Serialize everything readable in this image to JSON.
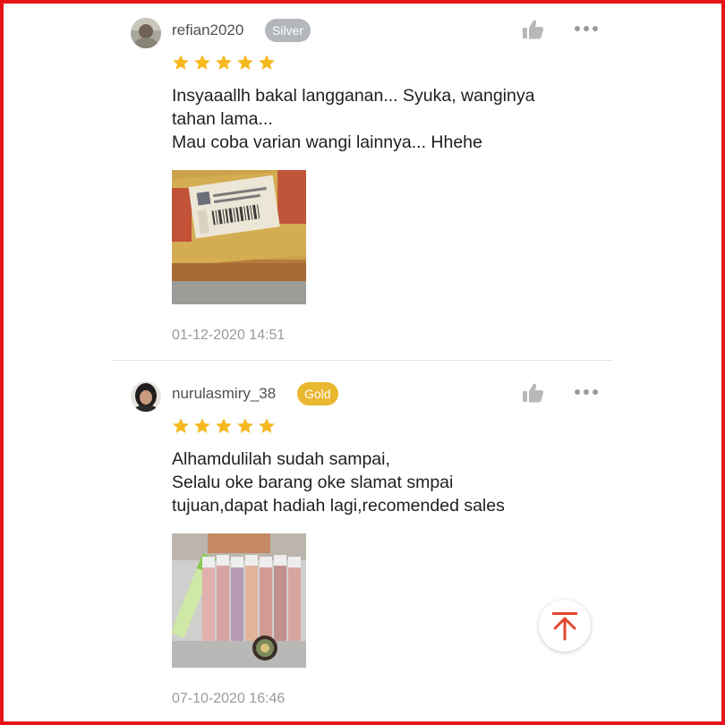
{
  "colors": {
    "frame": "#e8131a",
    "star": "#f5b81e",
    "badge_silver": "#b3b6bb",
    "badge_gold": "#e9b730",
    "scroll_top_arrow": "#e5462f"
  },
  "reviews": [
    {
      "username": "refian2020",
      "badge": "Silver",
      "rating": 5,
      "comment_lines": [
        "Insyaaallh bakal langganan... Syuka,  wanginya",
        "tahan lama...",
        "Mau coba varian wangi lainnya... Hhehe"
      ],
      "date": "01-12-2020 14:51",
      "icons": [
        "thumbs-up-icon",
        "more-options-icon"
      ]
    },
    {
      "username": "nurulasmiry_38",
      "badge": "Gold",
      "rating": 5,
      "comment_lines": [
        "Alhamdulilah sudah sampai,",
        "Selalu oke barang oke slamat smpai",
        "tujuan,dapat hadiah lagi,recomended sales"
      ],
      "date": "07-10-2020 16:46",
      "icons": [
        "thumbs-up-icon",
        "more-options-icon"
      ]
    }
  ],
  "scroll_top_icon": "arrow-to-top-icon"
}
